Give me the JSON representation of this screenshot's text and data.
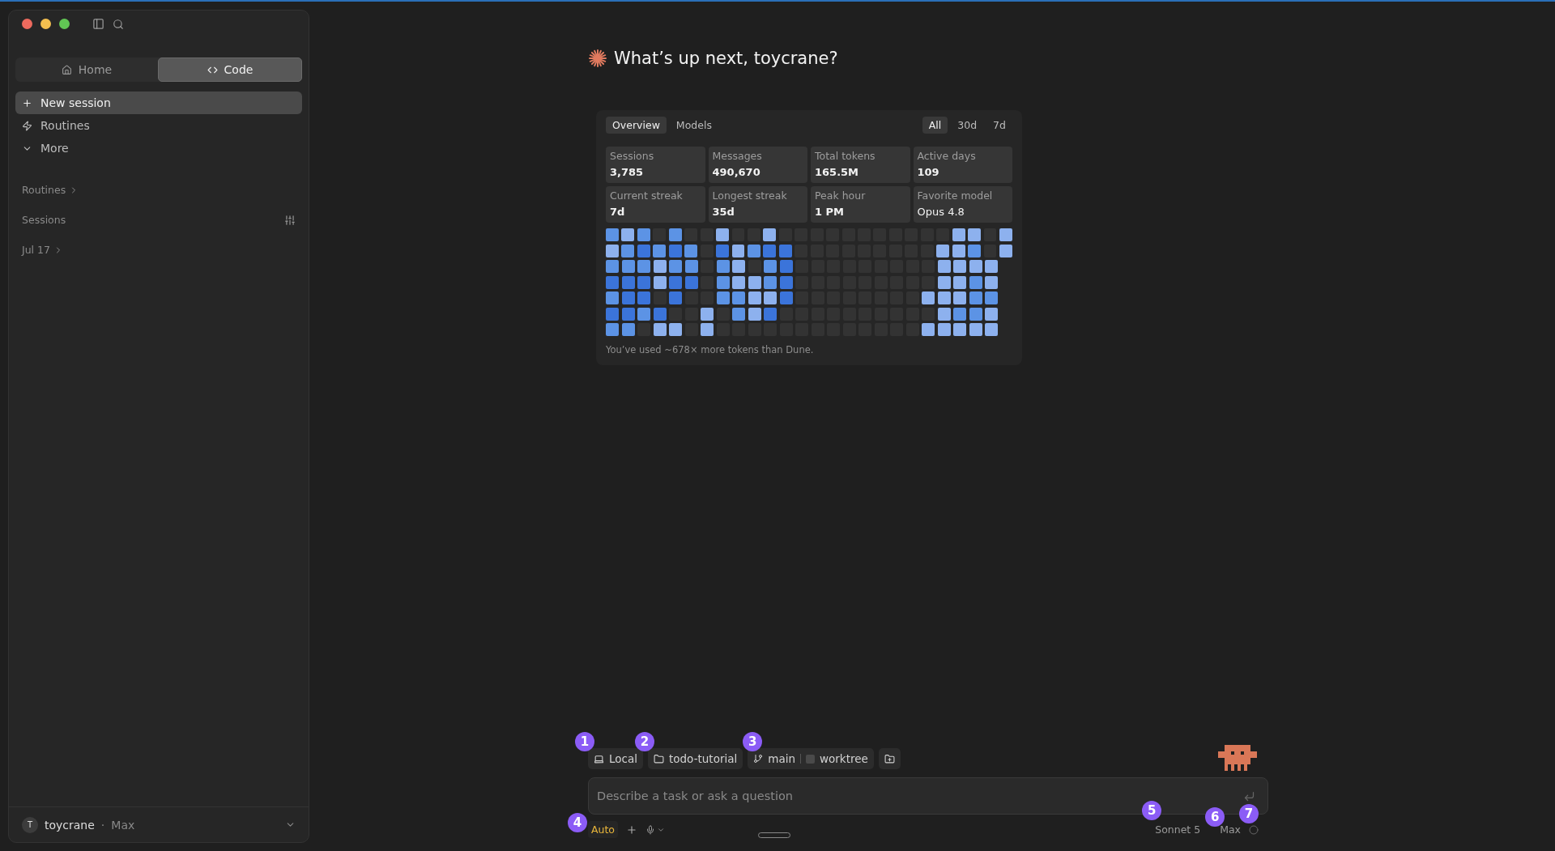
{
  "window": {
    "controls": [
      {
        "kind": "close"
      },
      {
        "kind": "minimize"
      },
      {
        "kind": "zoom"
      }
    ]
  },
  "sidebar": {
    "modes": [
      {
        "label": "Home",
        "selected": false
      },
      {
        "label": "Code",
        "selected": true
      }
    ],
    "nav": [
      {
        "label": "New session",
        "selected": true
      },
      {
        "label": "Routines",
        "selected": false
      },
      {
        "label": "More",
        "selected": false
      }
    ],
    "sections": [
      {
        "label": "Routines",
        "kind": "link"
      },
      {
        "label": "Sessions",
        "kind": "filter"
      },
      {
        "label": "Jul 17",
        "kind": "link"
      }
    ],
    "account": {
      "initial": "T",
      "name": "toycrane",
      "separator": "·",
      "plan": "Max"
    }
  },
  "greeting": "What’s up next, toycrane?",
  "stats": {
    "tabs": [
      {
        "label": "Overview",
        "selected": true
      },
      {
        "label": "Models",
        "selected": false
      }
    ],
    "ranges": [
      {
        "label": "All",
        "selected": true
      },
      {
        "label": "30d",
        "selected": false
      },
      {
        "label": "7d",
        "selected": false
      }
    ],
    "cards": [
      {
        "label": "Sessions",
        "value": "3,785",
        "bold": true
      },
      {
        "label": "Messages",
        "value": "490,670",
        "bold": true
      },
      {
        "label": "Total tokens",
        "value": "165.5M",
        "bold": true
      },
      {
        "label": "Active days",
        "value": "109",
        "bold": true
      },
      {
        "label": "Current streak",
        "value": "7d",
        "bold": true
      },
      {
        "label": "Longest streak",
        "value": "35d",
        "bold": true
      },
      {
        "label": "Peak hour",
        "value": "1 PM",
        "bold": true
      },
      {
        "label": "Favorite model",
        "value": "Opus 4.8",
        "bold": false
      }
    ],
    "heatmap": [
      [
        {
          "color": "#5c93e5"
        },
        {
          "color": "#8db1ee"
        },
        {
          "color": "#5c93e5"
        },
        {
          "color": "#333333"
        },
        {
          "color": "#5c93e5"
        },
        {
          "color": "#333333"
        },
        {
          "color": "#333333"
        },
        {
          "color": "#8db1ee"
        },
        {
          "color": "#333333"
        },
        {
          "color": "#333333"
        },
        {
          "color": "#8db1ee"
        },
        {
          "color": "#333333"
        },
        {
          "color": "#333333"
        },
        {
          "color": "#333333"
        },
        {
          "color": "#333333"
        },
        {
          "color": "#333333"
        },
        {
          "color": "#333333"
        },
        {
          "color": "#333333"
        },
        {
          "color": "#333333"
        },
        {
          "color": "#333333"
        },
        {
          "color": "#333333"
        },
        {
          "color": "#333333"
        },
        {
          "color": "#8db1ee"
        },
        {
          "color": "#8db1ee"
        },
        {
          "color": "#333333"
        },
        {
          "color": "#8db1ee"
        }
      ],
      [
        {
          "color": "#8db1ee"
        },
        {
          "color": "#5c93e5"
        },
        {
          "color": "#3b74da"
        },
        {
          "color": "#5c93e5"
        },
        {
          "color": "#3b74da"
        },
        {
          "color": "#5c93e5"
        },
        {
          "color": "#333333"
        },
        {
          "color": "#3b74da"
        },
        {
          "color": "#8db1ee"
        },
        {
          "color": "#5c93e5"
        },
        {
          "color": "#3b74da"
        },
        {
          "color": "#3b74da"
        },
        {
          "color": "#333333"
        },
        {
          "color": "#333333"
        },
        {
          "color": "#333333"
        },
        {
          "color": "#333333"
        },
        {
          "color": "#333333"
        },
        {
          "color": "#333333"
        },
        {
          "color": "#333333"
        },
        {
          "color": "#333333"
        },
        {
          "color": "#333333"
        },
        {
          "color": "#8db1ee"
        },
        {
          "color": "#8db1ee"
        },
        {
          "color": "#5c93e5"
        },
        {
          "color": "#333333"
        },
        {
          "color": "#8db1ee"
        }
      ],
      [
        {
          "color": "#5c93e5"
        },
        {
          "color": "#5c93e5"
        },
        {
          "color": "#5c93e5"
        },
        {
          "color": "#8db1ee"
        },
        {
          "color": "#5c93e5"
        },
        {
          "color": "#5c93e5"
        },
        {
          "color": "#333333"
        },
        {
          "color": "#5c93e5"
        },
        {
          "color": "#8db1ee"
        },
        {
          "color": "#333333"
        },
        {
          "color": "#5c93e5"
        },
        {
          "color": "#3b74da"
        },
        {
          "color": "#333333"
        },
        {
          "color": "#333333"
        },
        {
          "color": "#333333"
        },
        {
          "color": "#333333"
        },
        {
          "color": "#333333"
        },
        {
          "color": "#333333"
        },
        {
          "color": "#333333"
        },
        {
          "color": "#333333"
        },
        {
          "color": "#333333"
        },
        {
          "color": "#8db1ee"
        },
        {
          "color": "#8db1ee"
        },
        {
          "color": "#8db1ee"
        },
        {
          "color": "#8db1ee"
        }
      ],
      [
        {
          "color": "#3b74da"
        },
        {
          "color": "#3b74da"
        },
        {
          "color": "#3b74da"
        },
        {
          "color": "#8db1ee"
        },
        {
          "color": "#3b74da"
        },
        {
          "color": "#3b74da"
        },
        {
          "color": "#333333"
        },
        {
          "color": "#5c93e5"
        },
        {
          "color": "#8db1ee"
        },
        {
          "color": "#8db1ee"
        },
        {
          "color": "#5c93e5"
        },
        {
          "color": "#3b74da"
        },
        {
          "color": "#333333"
        },
        {
          "color": "#333333"
        },
        {
          "color": "#333333"
        },
        {
          "color": "#333333"
        },
        {
          "color": "#333333"
        },
        {
          "color": "#333333"
        },
        {
          "color": "#333333"
        },
        {
          "color": "#333333"
        },
        {
          "color": "#333333"
        },
        {
          "color": "#8db1ee"
        },
        {
          "color": "#8db1ee"
        },
        {
          "color": "#5c93e5"
        },
        {
          "color": "#8db1ee"
        }
      ],
      [
        {
          "color": "#5c93e5"
        },
        {
          "color": "#3b74da"
        },
        {
          "color": "#3b74da"
        },
        {
          "color": "#333333"
        },
        {
          "color": "#3b74da"
        },
        {
          "color": "#333333"
        },
        {
          "color": "#333333"
        },
        {
          "color": "#5c93e5"
        },
        {
          "color": "#5c93e5"
        },
        {
          "color": "#8db1ee"
        },
        {
          "color": "#8db1ee"
        },
        {
          "color": "#3b74da"
        },
        {
          "color": "#333333"
        },
        {
          "color": "#333333"
        },
        {
          "color": "#333333"
        },
        {
          "color": "#333333"
        },
        {
          "color": "#333333"
        },
        {
          "color": "#333333"
        },
        {
          "color": "#333333"
        },
        {
          "color": "#333333"
        },
        {
          "color": "#8db1ee"
        },
        {
          "color": "#8db1ee"
        },
        {
          "color": "#8db1ee"
        },
        {
          "color": "#5c93e5"
        },
        {
          "color": "#5c93e5"
        }
      ],
      [
        {
          "color": "#3b74da"
        },
        {
          "color": "#3b74da"
        },
        {
          "color": "#5c93e5"
        },
        {
          "color": "#3b74da"
        },
        {
          "color": "#333333"
        },
        {
          "color": "#333333"
        },
        {
          "color": "#8db1ee"
        },
        {
          "color": "#333333"
        },
        {
          "color": "#5c93e5"
        },
        {
          "color": "#8db1ee"
        },
        {
          "color": "#3b74da"
        },
        {
          "color": "#333333"
        },
        {
          "color": "#333333"
        },
        {
          "color": "#333333"
        },
        {
          "color": "#333333"
        },
        {
          "color": "#333333"
        },
        {
          "color": "#333333"
        },
        {
          "color": "#333333"
        },
        {
          "color": "#333333"
        },
        {
          "color": "#333333"
        },
        {
          "color": "#333333"
        },
        {
          "color": "#8db1ee"
        },
        {
          "color": "#5c93e5"
        },
        {
          "color": "#5c93e5"
        },
        {
          "color": "#8db1ee"
        }
      ],
      [
        {
          "color": "#5c93e5"
        },
        {
          "color": "#5c93e5"
        },
        {
          "color": "#333333"
        },
        {
          "color": "#8db1ee"
        },
        {
          "color": "#8db1ee"
        },
        {
          "color": "#333333"
        },
        {
          "color": "#8db1ee"
        },
        {
          "color": "#333333"
        },
        {
          "color": "#333333"
        },
        {
          "color": "#333333"
        },
        {
          "color": "#333333"
        },
        {
          "color": "#333333"
        },
        {
          "color": "#333333"
        },
        {
          "color": "#333333"
        },
        {
          "color": "#333333"
        },
        {
          "color": "#333333"
        },
        {
          "color": "#333333"
        },
        {
          "color": "#333333"
        },
        {
          "color": "#333333"
        },
        {
          "color": "#333333"
        },
        {
          "color": "#8db1ee"
        },
        {
          "color": "#8db1ee"
        },
        {
          "color": "#8db1ee"
        },
        {
          "color": "#8db1ee"
        },
        {
          "color": "#8db1ee"
        }
      ]
    ],
    "footnote": "You’ve used ~678× more tokens than Dune."
  },
  "composer": {
    "chips": [
      {
        "kind": "chip",
        "label": "Local",
        "badge": "1"
      },
      {
        "kind": "chip",
        "label": "todo-tutorial",
        "badge": "2"
      },
      {
        "kind": "split",
        "label": "main",
        "extra": "worktree",
        "badge": "3"
      },
      {
        "kind": "icon"
      }
    ],
    "placeholder": "Describe a task or ask a question",
    "mode": {
      "label": "Auto",
      "badge": "4"
    },
    "model": {
      "label": "Sonnet 5",
      "badge": "5"
    },
    "effort": {
      "label": "Max",
      "badge": "6"
    },
    "status_badge": "7"
  }
}
